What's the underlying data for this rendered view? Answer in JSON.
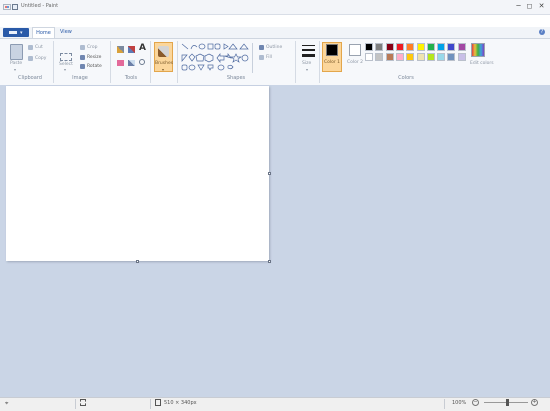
{
  "window": {
    "title": "Untitled - Paint",
    "min": "─",
    "max": "◻",
    "close": "✕"
  },
  "tabs": {
    "file": "",
    "home": "Home",
    "view": "View"
  },
  "ribbon": {
    "clipboard": {
      "paste": "Paste",
      "cut": "Cut",
      "copy": "Copy",
      "label": "Clipboard"
    },
    "image": {
      "select": "Select",
      "crop": "Crop",
      "resize": "Resize",
      "rotate": "Rotate",
      "label": "Image"
    },
    "tools": {
      "label": "Tools"
    },
    "brushes": {
      "label": "Brushes"
    },
    "shapes": {
      "outline": "Outline",
      "fill": "Fill",
      "label": "Shapes"
    },
    "size": {
      "label": "Size"
    },
    "colors": {
      "color1": "Color 1",
      "color2": "Color 2",
      "edit": "Edit colors",
      "label": "Colors",
      "row1": [
        "#000000",
        "#7f7f7f",
        "#880015",
        "#ed1c24",
        "#ff7f27",
        "#fff200",
        "#22b14c",
        "#00a2e8",
        "#3f48cc",
        "#a349a4"
      ],
      "row2": [
        "#ffffff",
        "#c3c3c3",
        "#b97a57",
        "#ffaec9",
        "#ffc90e",
        "#efe4b0",
        "#b5e61d",
        "#99d9ea",
        "#7092be",
        "#c8bfe7"
      ]
    }
  },
  "status": {
    "canvas_size": "510 × 340px",
    "zoom": "100%",
    "zoom_out": "−",
    "zoom_in": "+"
  }
}
